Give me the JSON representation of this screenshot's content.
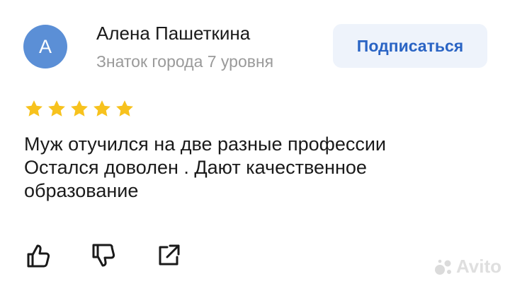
{
  "user": {
    "avatar_letter": "А",
    "name": "Алена Пашеткина",
    "level": "Знаток города 7 уровня"
  },
  "subscribe_label": "Подписаться",
  "rating": {
    "value": 5,
    "max": 5
  },
  "review": {
    "lines": [
      "Муж отучился на две разные профессии",
      "Остался доволен . Дают качественное",
      "образование"
    ]
  },
  "actions": [
    "thumbs-up-icon",
    "thumbs-down-icon",
    "share-icon"
  ],
  "watermark": "Avito",
  "colors": {
    "avatar": "#5b8fd6",
    "subscribe_bg": "#eef3fb",
    "subscribe_text": "#2a64c4",
    "star": "#f7c21d",
    "secondary_text": "#9a9a9a"
  }
}
